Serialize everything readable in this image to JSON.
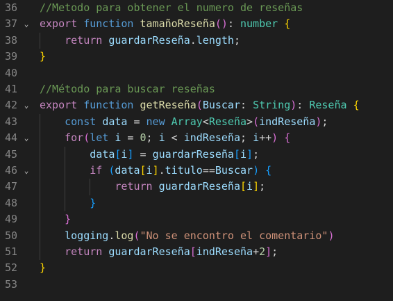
{
  "editor": {
    "line_numbers": [
      "36",
      "37",
      "38",
      "39",
      "40",
      "41",
      "42",
      "43",
      "44",
      "45",
      "46",
      "47",
      "48",
      "49",
      "50",
      "51",
      "52",
      "53"
    ],
    "lines": [
      [
        {
          "t": "//Metodo para obtener el numero de reseñas",
          "c": "cm"
        }
      ],
      [
        {
          "t": "export",
          "c": "kc"
        },
        {
          "t": " ",
          "c": "pl"
        },
        {
          "t": "function",
          "c": "kw"
        },
        {
          "t": " ",
          "c": "pl"
        },
        {
          "t": "tamañoReseña",
          "c": "fn"
        },
        {
          "t": "()",
          "c": "p2"
        },
        {
          "t": ": ",
          "c": "pl"
        },
        {
          "t": "number",
          "c": "ty"
        },
        {
          "t": " ",
          "c": "pl"
        },
        {
          "t": "{",
          "c": "p1"
        }
      ],
      [
        {
          "t": "    ",
          "c": "pl"
        },
        {
          "t": "return",
          "c": "kc"
        },
        {
          "t": " ",
          "c": "pl"
        },
        {
          "t": "guardarReseña",
          "c": "va"
        },
        {
          "t": ".",
          "c": "pl"
        },
        {
          "t": "length",
          "c": "va"
        },
        {
          "t": ";",
          "c": "pl"
        }
      ],
      [
        {
          "t": "}",
          "c": "p1"
        }
      ],
      [],
      [
        {
          "t": "//Método para buscar reseñas",
          "c": "cm"
        }
      ],
      [
        {
          "t": "export",
          "c": "kc"
        },
        {
          "t": " ",
          "c": "pl"
        },
        {
          "t": "function",
          "c": "kw"
        },
        {
          "t": " ",
          "c": "pl"
        },
        {
          "t": "getReseña",
          "c": "fn"
        },
        {
          "t": "(",
          "c": "p2"
        },
        {
          "t": "Buscar",
          "c": "va"
        },
        {
          "t": ": ",
          "c": "pl"
        },
        {
          "t": "String",
          "c": "ty"
        },
        {
          "t": ")",
          "c": "p2"
        },
        {
          "t": ": ",
          "c": "pl"
        },
        {
          "t": "Reseña",
          "c": "ty"
        },
        {
          "t": " ",
          "c": "pl"
        },
        {
          "t": "{",
          "c": "p1"
        }
      ],
      [
        {
          "t": "    ",
          "c": "pl"
        },
        {
          "t": "const",
          "c": "kw"
        },
        {
          "t": " ",
          "c": "pl"
        },
        {
          "t": "data",
          "c": "va"
        },
        {
          "t": " = ",
          "c": "pl"
        },
        {
          "t": "new",
          "c": "kw"
        },
        {
          "t": " ",
          "c": "pl"
        },
        {
          "t": "Array",
          "c": "ty"
        },
        {
          "t": "<",
          "c": "pl"
        },
        {
          "t": "Reseña",
          "c": "ty"
        },
        {
          "t": ">",
          "c": "pl"
        },
        {
          "t": "(",
          "c": "p2"
        },
        {
          "t": "indReseña",
          "c": "va"
        },
        {
          "t": ")",
          "c": "p2"
        },
        {
          "t": ";",
          "c": "pl"
        }
      ],
      [
        {
          "t": "    ",
          "c": "pl"
        },
        {
          "t": "for",
          "c": "kc"
        },
        {
          "t": "(",
          "c": "p2"
        },
        {
          "t": "let",
          "c": "kw"
        },
        {
          "t": " ",
          "c": "pl"
        },
        {
          "t": "i",
          "c": "va"
        },
        {
          "t": " = ",
          "c": "pl"
        },
        {
          "t": "0",
          "c": "nu"
        },
        {
          "t": "; ",
          "c": "pl"
        },
        {
          "t": "i",
          "c": "va"
        },
        {
          "t": " < ",
          "c": "pl"
        },
        {
          "t": "indReseña",
          "c": "va"
        },
        {
          "t": "; ",
          "c": "pl"
        },
        {
          "t": "i",
          "c": "va"
        },
        {
          "t": "++",
          "c": "pl"
        },
        {
          "t": ")",
          "c": "p2"
        },
        {
          "t": " ",
          "c": "pl"
        },
        {
          "t": "{",
          "c": "p2"
        }
      ],
      [
        {
          "t": "        ",
          "c": "pl"
        },
        {
          "t": "data",
          "c": "va"
        },
        {
          "t": "[",
          "c": "p3"
        },
        {
          "t": "i",
          "c": "va"
        },
        {
          "t": "]",
          "c": "p3"
        },
        {
          "t": " = ",
          "c": "pl"
        },
        {
          "t": "guardarReseña",
          "c": "va"
        },
        {
          "t": "[",
          "c": "p3"
        },
        {
          "t": "i",
          "c": "va"
        },
        {
          "t": "]",
          "c": "p3"
        },
        {
          "t": ";",
          "c": "pl"
        }
      ],
      [
        {
          "t": "        ",
          "c": "pl"
        },
        {
          "t": "if",
          "c": "kc"
        },
        {
          "t": " ",
          "c": "pl"
        },
        {
          "t": "(",
          "c": "p3"
        },
        {
          "t": "data",
          "c": "va"
        },
        {
          "t": "[",
          "c": "p1"
        },
        {
          "t": "i",
          "c": "va"
        },
        {
          "t": "]",
          "c": "p1"
        },
        {
          "t": ".",
          "c": "pl"
        },
        {
          "t": "titulo",
          "c": "va"
        },
        {
          "t": "==",
          "c": "pl"
        },
        {
          "t": "Buscar",
          "c": "va"
        },
        {
          "t": ")",
          "c": "p3"
        },
        {
          "t": " ",
          "c": "pl"
        },
        {
          "t": "{",
          "c": "p3"
        }
      ],
      [
        {
          "t": "            ",
          "c": "pl"
        },
        {
          "t": "return",
          "c": "kc"
        },
        {
          "t": " ",
          "c": "pl"
        },
        {
          "t": "guardarReseña",
          "c": "va"
        },
        {
          "t": "[",
          "c": "p1"
        },
        {
          "t": "i",
          "c": "va"
        },
        {
          "t": "]",
          "c": "p1"
        },
        {
          "t": ";",
          "c": "pl"
        }
      ],
      [
        {
          "t": "        ",
          "c": "pl"
        },
        {
          "t": "}",
          "c": "p3"
        }
      ],
      [
        {
          "t": "    ",
          "c": "pl"
        },
        {
          "t": "}",
          "c": "p2"
        }
      ],
      [
        {
          "t": "    ",
          "c": "pl"
        },
        {
          "t": "logging",
          "c": "va"
        },
        {
          "t": ".",
          "c": "pl"
        },
        {
          "t": "log",
          "c": "fn"
        },
        {
          "t": "(",
          "c": "p2"
        },
        {
          "t": "\"No se encontro el comentario\"",
          "c": "st"
        },
        {
          "t": ")",
          "c": "p2"
        }
      ],
      [
        {
          "t": "    ",
          "c": "pl"
        },
        {
          "t": "return",
          "c": "kc"
        },
        {
          "t": " ",
          "c": "pl"
        },
        {
          "t": "guardarReseña",
          "c": "va"
        },
        {
          "t": "[",
          "c": "p2"
        },
        {
          "t": "indReseña",
          "c": "va"
        },
        {
          "t": "+",
          "c": "pl"
        },
        {
          "t": "2",
          "c": "nu"
        },
        {
          "t": "]",
          "c": "p2"
        },
        {
          "t": ";",
          "c": "pl"
        }
      ],
      [
        {
          "t": "}",
          "c": "p1"
        }
      ],
      []
    ],
    "fold_lines": [
      37,
      42,
      44,
      46
    ],
    "fold_icon": "chevron-down-icon"
  }
}
